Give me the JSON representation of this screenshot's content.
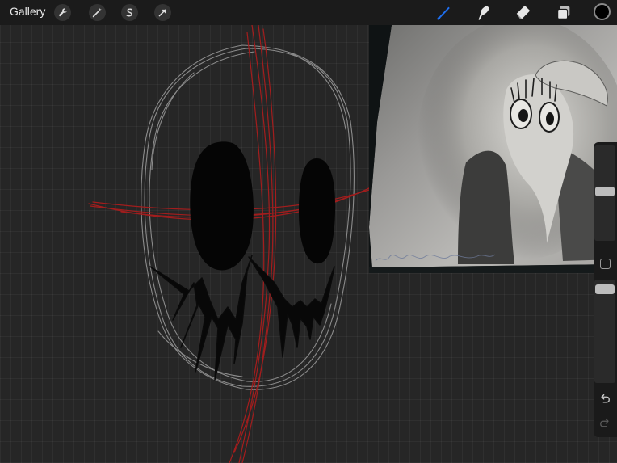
{
  "toolbar": {
    "gallery_label": "Gallery",
    "actions": [
      {
        "name": "actions",
        "icon": "wrench-icon"
      },
      {
        "name": "adjustments",
        "icon": "magic-wand-icon"
      },
      {
        "name": "selection",
        "icon": "selection-s-icon"
      },
      {
        "name": "transform",
        "icon": "arrow-cursor-icon"
      }
    ],
    "tools": [
      {
        "name": "brush",
        "icon": "brush-icon",
        "active": true
      },
      {
        "name": "smudge",
        "icon": "smudge-icon",
        "active": false
      },
      {
        "name": "eraser",
        "icon": "eraser-icon",
        "active": false
      },
      {
        "name": "layers",
        "icon": "layers-icon",
        "active": false
      }
    ],
    "current_color": "#000000"
  },
  "sidebar": {
    "brush_size_level": 0.52,
    "opacity_level": 0.95,
    "icons": [
      "modify-square-icon",
      "undo-icon",
      "redo-icon"
    ]
  },
  "colors": {
    "canvas": "#262626",
    "toolbar": "#1b1b1b",
    "accent_active_tool": "#1e6ff0",
    "sketch_red": "#b01c1c",
    "sketch_gray": "#8a8a8a"
  }
}
